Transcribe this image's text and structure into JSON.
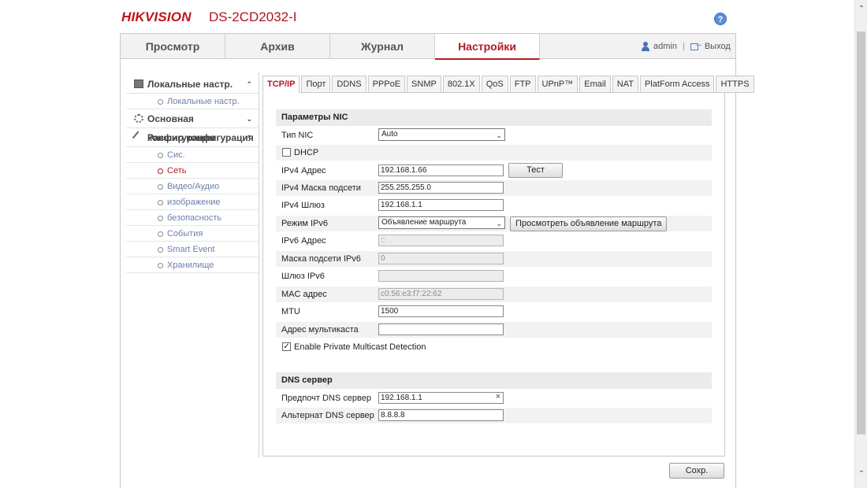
{
  "header": {
    "brand": "HIKVISION",
    "model": "DS-2CD2032-I",
    "help_icon": "?"
  },
  "topnav": {
    "tabs": [
      {
        "label": "Просмотр"
      },
      {
        "label": "Архив"
      },
      {
        "label": "Журнал"
      },
      {
        "label": "Настройки",
        "active": true
      }
    ],
    "user": "admin",
    "separator": "|",
    "logout": "Выход"
  },
  "sidebar": {
    "sections": [
      {
        "label": "Локальные настр.",
        "expanded": true,
        "chevron": "⌃",
        "items": [
          {
            "label": "Локальные настр."
          }
        ]
      },
      {
        "label": "Основная конфигурация",
        "expanded": false,
        "chevron": "⌄",
        "items": []
      },
      {
        "label": "Расшир конфигурация",
        "expanded": true,
        "chevron": "⌃",
        "items": [
          {
            "label": "Сис."
          },
          {
            "label": "Сеть",
            "active": true
          },
          {
            "label": "Видео/Аудио"
          },
          {
            "label": "изображение"
          },
          {
            "label": "безопасность"
          },
          {
            "label": "События"
          },
          {
            "label": "Smart Event"
          },
          {
            "label": "Хранилище"
          }
        ]
      }
    ]
  },
  "content_tabs": [
    "TCP/IP",
    "Порт",
    "DDNS",
    "PPPoE",
    "SNMP",
    "802.1X",
    "QoS",
    "FTP",
    "UPnP™",
    "Email",
    "NAT",
    "PlatForm Access",
    "HTTPS"
  ],
  "nic": {
    "title": "Параметры NIC",
    "nic_type_label": "Тип NIC",
    "nic_type_value": "Auto",
    "dhcp_label": "DHCP",
    "dhcp_checked": false,
    "ipv4_addr_label": "IPv4 Адрес",
    "ipv4_addr": "192.168.1.66",
    "test_button": "Тест",
    "ipv4_mask_label": "IPv4 Маска подсети",
    "ipv4_mask": "255.255.255.0",
    "ipv4_gw_label": "IPv4 Шлюз",
    "ipv4_gw": "192.168.1.1",
    "ipv6_mode_label": "Режим IPv6",
    "ipv6_mode_value": "Объявление маршрута",
    "view_route_button": "Просмотреть объявление маршрута",
    "ipv6_addr_label": "IPv6 Адрес",
    "ipv6_addr": "::",
    "ipv6_mask_label": "Маска подсети IPv6",
    "ipv6_mask": "0",
    "ipv6_gw_label": "Шлюз IPv6",
    "ipv6_gw": "",
    "mac_label": "MAC адрес",
    "mac": "c0:56:e3:f7:22:62",
    "mtu_label": "MTU",
    "mtu": "1500",
    "multicast_label": "Адрес мультикаста",
    "multicast": "",
    "private_multicast_label": "Enable Private Multicast Detection",
    "private_multicast_checked": true
  },
  "dns": {
    "title": "DNS сервер",
    "preferred_label": "Предпочт DNS сервер",
    "preferred": "192.168.1.1",
    "alternate_label": "Альтернат DNS сервер",
    "alternate": "8.8.8.8"
  },
  "save_button": "Сохр.",
  "icons": {
    "check": "✓",
    "dropdown": "⌄",
    "clear": "×",
    "scroll_up": "⌃",
    "scroll_down": "⌄"
  },
  "colors": {
    "accent": "#b31b22",
    "link": "#6b7fa8",
    "brand": "#c0141c"
  }
}
